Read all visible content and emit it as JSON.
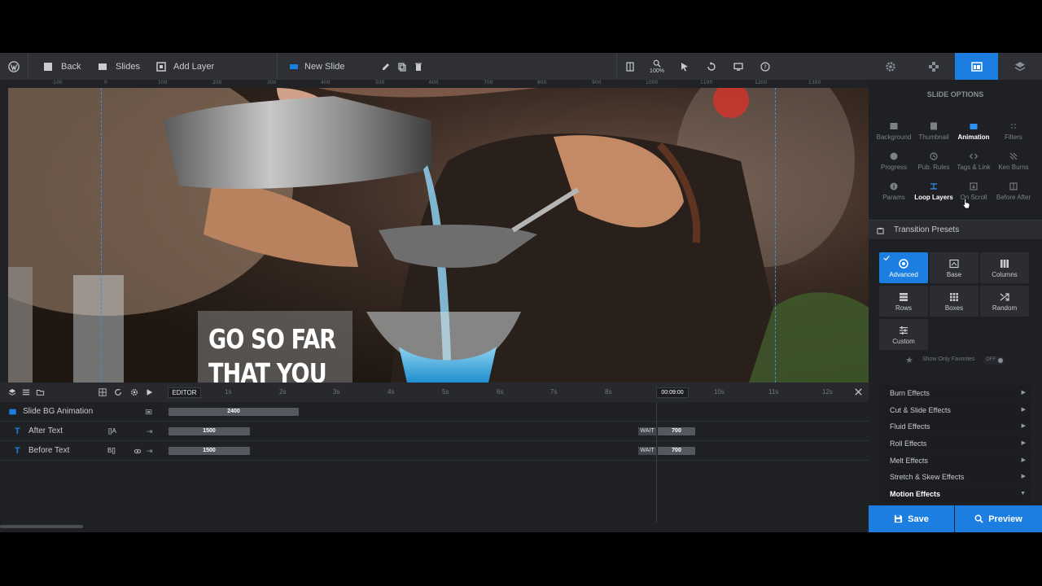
{
  "toolbar": {
    "back": "Back",
    "slides": "Slides",
    "add_layer": "Add Layer",
    "slide_name": "New Slide",
    "zoom": "100%"
  },
  "ruler": {
    "ticks": [
      "-100",
      "0",
      "100",
      "200",
      "300",
      "400",
      "500",
      "600",
      "700",
      "800",
      "900",
      "1000",
      "1100",
      "1200",
      "1300"
    ]
  },
  "canvas": {
    "headline_line1": "GO SO FAR",
    "headline_line2": "THAT YOU"
  },
  "timeline": {
    "editor_label": "EDITOR",
    "time_marks": [
      "1s",
      "2s",
      "3s",
      "4s",
      "5s",
      "6s",
      "7s",
      "8s",
      "9s",
      "10s",
      "11s",
      "12s"
    ],
    "playhead": "00:09:00",
    "rows": [
      {
        "name": "Slide BG Animation",
        "duration": "2400",
        "icons": ""
      },
      {
        "name": "After Text",
        "duration": "1500",
        "icons": "[]A",
        "wait": "WAIT",
        "wait_value": "700"
      },
      {
        "name": "Before Text",
        "duration": "1500",
        "icons": "B[]",
        "wait": "WAIT",
        "wait_value": "700"
      }
    ]
  },
  "panel": {
    "title": "SLIDE OPTIONS",
    "options": [
      {
        "label": "Background",
        "icon": "image-icon"
      },
      {
        "label": "Thumbnail",
        "icon": "thumbnail-icon"
      },
      {
        "label": "Animation",
        "icon": "animation-icon",
        "active": true
      },
      {
        "label": "Filters",
        "icon": "filters-icon"
      },
      {
        "label": "Progress",
        "icon": "progress-icon"
      },
      {
        "label": "Pub. Rules",
        "icon": "clock-icon"
      },
      {
        "label": "Tags & Link",
        "icon": "code-icon"
      },
      {
        "label": "Ken Burns",
        "icon": "kenburns-icon"
      },
      {
        "label": "Params",
        "icon": "info-icon"
      },
      {
        "label": "Loop Layers",
        "icon": "loop-icon",
        "bold": true
      },
      {
        "label": "On Scroll",
        "icon": "scroll-icon"
      },
      {
        "label": "Before After",
        "icon": "before-after-icon"
      }
    ],
    "presets_title": "Transition Presets",
    "presets": [
      {
        "label": "Advanced",
        "icon": "advanced-icon",
        "active": true
      },
      {
        "label": "Base",
        "icon": "base-icon"
      },
      {
        "label": "Columns",
        "icon": "columns-icon"
      },
      {
        "label": "Rows",
        "icon": "rows-icon"
      },
      {
        "label": "Boxes",
        "icon": "boxes-icon"
      },
      {
        "label": "Random",
        "icon": "random-icon"
      },
      {
        "label": "Custom",
        "icon": "custom-icon"
      }
    ],
    "favorites_label": "Show Only Favorites",
    "favorites_toggle": "OFF",
    "effects": [
      "Burn Effects",
      "Cut & Slide Effects",
      "Fluid Effects",
      "Roll Effects",
      "Melt Effects",
      "Stretch & Skew Effects",
      "Motion Effects"
    ],
    "save": "Save",
    "preview": "Preview"
  },
  "colors": {
    "accent": "#1c7ee0",
    "toolbar_bg": "#2e3035",
    "panel_bg": "#1e2024"
  }
}
